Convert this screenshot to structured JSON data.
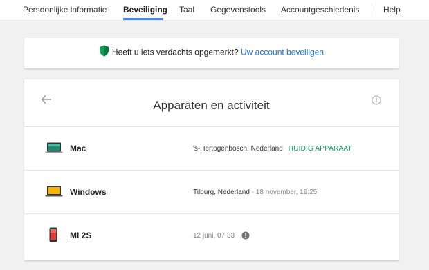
{
  "nav": {
    "tabs": [
      {
        "label": "Persoonlijke informatie"
      },
      {
        "label": "Beveiliging"
      },
      {
        "label": "Taal"
      },
      {
        "label": "Gegevenstools"
      },
      {
        "label": "Accountgeschiedenis"
      },
      {
        "label": "Help"
      }
    ],
    "active_tab": "Beveiliging"
  },
  "banner": {
    "icon": "shield-check-icon",
    "text": "Heeft u iets verdachts opgemerkt? ",
    "link": "Uw account beveiligen"
  },
  "devices_card": {
    "title": "Apparaten en activiteit",
    "back_icon": "arrow-left-icon",
    "info_icon": "info-icon",
    "devices": [
      {
        "name": "Mac",
        "icon": "laptop-icon",
        "location": "'s-Hertogenbosch, Nederland",
        "status": "HUIDIG APPARAAT"
      },
      {
        "name": "Windows",
        "icon": "laptop-icon",
        "location": "Tilburg, Nederland",
        "time": " - 18 november, 19:25"
      },
      {
        "name": "MI 2S",
        "icon": "phone-icon",
        "time": "12 juni, 07:33",
        "alert_icon": "alert-icon"
      }
    ]
  },
  "colors": {
    "accent": "#4285f4",
    "link": "#1a73e8",
    "status_green": "#0f9d58",
    "shield_green": "#0f9d58",
    "background": "#f1f1f1"
  }
}
